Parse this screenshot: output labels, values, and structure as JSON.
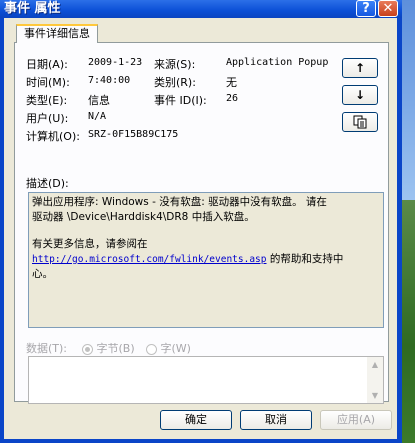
{
  "window": {
    "title": "事件 属性",
    "help_glyph": "?",
    "close_glyph": "✕"
  },
  "tabs": [
    {
      "label": "事件详细信息"
    }
  ],
  "fields": {
    "date_label": "日期(A):",
    "date_value": "2009-1-23",
    "source_label": "来源(S):",
    "source_value": "Application Popup",
    "time_label": "时间(M):",
    "time_value": "7:40:00",
    "category_label": "类别(R):",
    "category_value": "无",
    "type_label": "类型(E):",
    "type_value": "信息",
    "event_id_label": "事件 ID(I):",
    "event_id_value": "26",
    "user_label": "用户(U):",
    "user_value": "N/A",
    "computer_label": "计算机(O):",
    "computer_value": "SRZ-0F15B89C175"
  },
  "nav_buttons": {
    "up": "↑",
    "down": "↓",
    "copy": "copy-icon"
  },
  "description": {
    "label": "描述(D):",
    "line1": "弹出应用程序: Windows - 没有软盘: 驱动器中没有软盘。 请在",
    "line2": "驱动器 \\Device\\Harddisk4\\DR8 中插入软盘。",
    "line3": "有关更多信息，请参阅在",
    "link": "http://go.microsoft.com/fwlink/events.asp",
    "line3_suffix": "的帮助和支持中",
    "line4": "心。"
  },
  "data_section": {
    "label": "数据(T):",
    "bytes_label": "字节(B)",
    "words_label": "字(W)",
    "selected": "bytes"
  },
  "buttons": {
    "ok": "确定",
    "cancel": "取消",
    "apply": "应用(A)"
  }
}
